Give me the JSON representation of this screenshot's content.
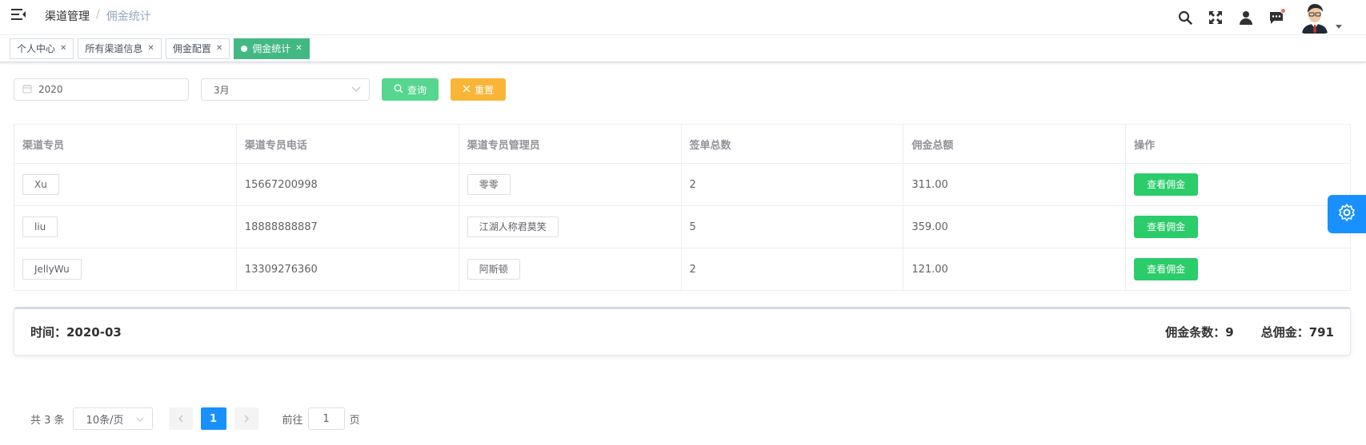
{
  "header": {
    "breadcrumb": {
      "parent": "渠道管理",
      "separator": "/",
      "current": "佣金统计"
    },
    "icons": [
      "hamburger-icon",
      "search-icon",
      "fullscreen-icon",
      "user-icon",
      "message-icon"
    ],
    "has_notification": true
  },
  "tags": [
    {
      "label": "个人中心",
      "active": false
    },
    {
      "label": "所有渠道信息",
      "active": false
    },
    {
      "label": "佣金配置",
      "active": false
    },
    {
      "label": "佣金统计",
      "active": true
    }
  ],
  "filters": {
    "year": "2020",
    "month": "3月",
    "query_label": "查询",
    "reset_label": "重置"
  },
  "table": {
    "columns": [
      "渠道专员",
      "渠道专员电话",
      "渠道专员管理员",
      "签单总数",
      "佣金总额",
      "操作"
    ],
    "rows": [
      {
        "agent": "Xu",
        "phone": "15667200998",
        "manager": "零零",
        "orders": "2",
        "total": "311.00",
        "action": "查看佣金"
      },
      {
        "agent": "liu",
        "phone": "18888888887",
        "manager": "江湖人称君莫笑",
        "orders": "5",
        "total": "359.00",
        "action": "查看佣金"
      },
      {
        "agent": "JellyWu",
        "phone": "13309276360",
        "manager": "阿斯顿",
        "orders": "2",
        "total": "121.00",
        "action": "查看佣金"
      }
    ]
  },
  "summary": {
    "time": "时间：2020-03",
    "count": "佣金条数：9",
    "total": "总佣金：791"
  },
  "pagination": {
    "total_text": "共 3 条",
    "page_size": "10条/页",
    "current_page": "1",
    "goto_label": "前往",
    "goto_value": "1",
    "page_suffix": "页"
  },
  "colors": {
    "accent": "#42b983",
    "query": "#56d68f",
    "reset": "#f8b537",
    "action": "#2bcc6a",
    "primary": "#1890ff"
  }
}
